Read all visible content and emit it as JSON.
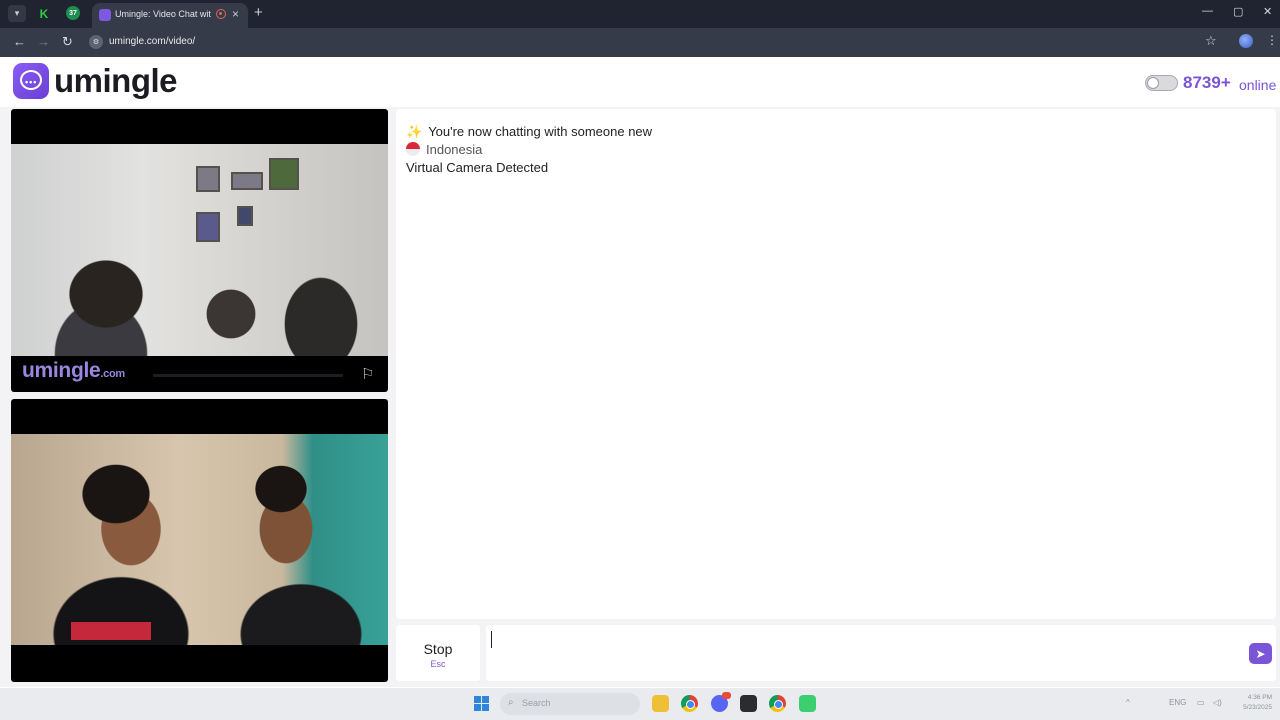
{
  "browser": {
    "active_tab_title": "Umingle: Video Chat with S",
    "url": "umingle.com/video/",
    "pinned_tab_2_badge": "37"
  },
  "header": {
    "logo_text": "umingle",
    "online_count": "8739+",
    "online_label": "online"
  },
  "video": {
    "watermark": "umingle",
    "watermark_suffix": ".com"
  },
  "chat": {
    "messages": [
      "You're now chatting with someone new",
      "Indonesia",
      "Virtual Camera Detected"
    ]
  },
  "controls": {
    "stop_label": "Stop",
    "stop_shortcut": "Esc",
    "input_value": ""
  },
  "taskbar": {
    "search_placeholder": "Search",
    "language": "ENG",
    "time": "4:36 PM",
    "date": "5/23/2025"
  },
  "colors": {
    "brand": "#7a55d8",
    "chrome_dark": "#1f2430",
    "chrome_bar": "#353b48"
  },
  "icons": [
    "tab-list-icon",
    "close-icon",
    "new-tab-icon",
    "back-icon",
    "forward-icon",
    "reload-icon",
    "star-icon",
    "menu-icon",
    "flag-icon",
    "send-icon",
    "sparkle-icon"
  ]
}
